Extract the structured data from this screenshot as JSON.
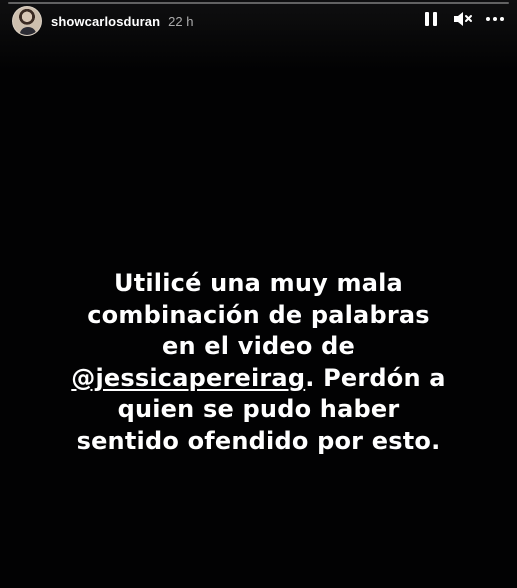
{
  "story": {
    "username": "showcarlosduran",
    "timestamp": "22 h",
    "progress": 0.0
  },
  "controls": {
    "pause_icon": "pause-icon",
    "mute_icon": "volume-muted-icon",
    "more_icon": "more-options-icon"
  },
  "caption": {
    "line1": "Utilicé una muy mala",
    "line2": "combinación de palabras",
    "line3": "en el video de",
    "mention": "@jessicapereirag",
    "line4_rest": ". Perdón a",
    "line5": "quien se pudo haber",
    "line6": "sentido ofendido por esto."
  }
}
